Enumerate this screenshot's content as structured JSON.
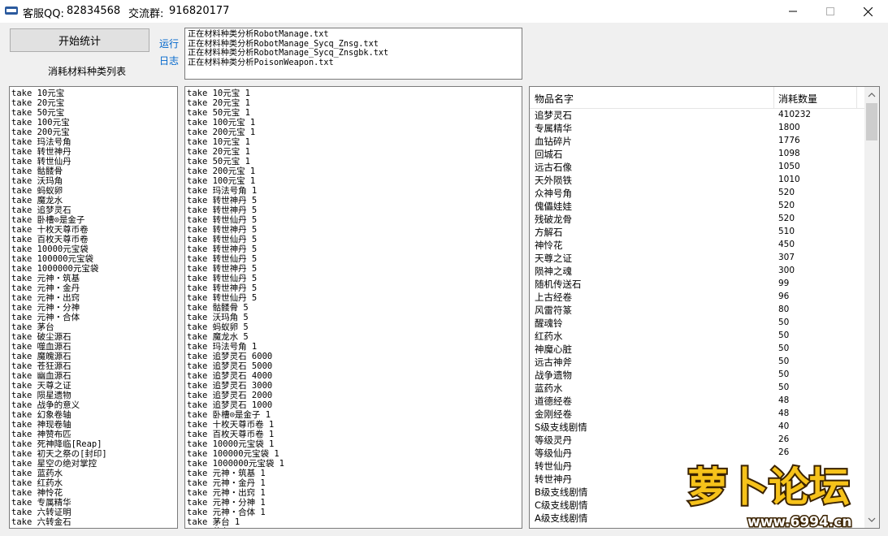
{
  "titlebar": {
    "qq_label": "客服QQ:",
    "qq_value": "82834568",
    "group_label": "交流群:",
    "group_value": "916820177"
  },
  "toolbar": {
    "start_button": "开始统计",
    "list_label": "消耗材料种类列表",
    "link_run": "运行",
    "link_log": "日志"
  },
  "log_lines": [
    "正在材料种类分析RobotManage.txt",
    "正在材料种类分析RobotManage_Sycq_Znsg.txt",
    "正在材料种类分析RobotManage_Sycq_Znsgbk.txt",
    "正在材料种类分析PoisonWeapon.txt"
  ],
  "type_list": [
    "take 10元宝",
    "take 20元宝",
    "take 50元宝",
    "take 100元宝",
    "take 200元宝",
    "take 玛法号角",
    "take 转世神丹",
    "take 转世仙丹",
    "take 骷髅骨",
    "take 沃玛角",
    "take 蚂蚁卵",
    "take 魔龙水",
    "take 追梦灵石",
    "take 卧槽⊙是金子",
    "take 十枚天尊币卷",
    "take 百枚天尊币卷",
    "take 10000元宝袋",
    "take 100000元宝袋",
    "take 1000000元宝袋",
    "take 元神・筑基",
    "take 元神・金丹",
    "take 元神・出窍",
    "take 元神・分神",
    "take 元神・合体",
    "take 茅台",
    "take 破尘源石",
    "take 噬血源石",
    "take 魔魄源石",
    "take 苍狂源石",
    "take 幽血源石",
    "take 天尊之证",
    "take 陨星遗物",
    "take 战争的意义",
    "take 幻象卷轴",
    "take 神现卷轴",
    "take 神赞布匹",
    "take 死神降临[Reap]",
    "take 初天之祭の[封印]",
    "take 星空の绝对掌控",
    "take 蓝药水",
    "take 红药水",
    "take 神怜花",
    "take 专属精华",
    "take 六转证明",
    "take 六转金石"
  ],
  "take_list": [
    "take 10元宝 1",
    "take 20元宝 1",
    "take 50元宝 1",
    "take 100元宝 1",
    "take 200元宝 1",
    "take 10元宝 1",
    "take 20元宝 1",
    "take 50元宝 1",
    "take 200元宝 1",
    "take 100元宝 1",
    "take 玛法号角 1",
    "take 转世神丹 5",
    "take 转世神丹 5",
    "take 转世仙丹 5",
    "take 转世神丹 5",
    "take 转世仙丹 5",
    "take 转世神丹 5",
    "take 转世仙丹 5",
    "take 转世神丹 5",
    "take 转世仙丹 5",
    "take 转世神丹 5",
    "take 转世仙丹 5",
    "take 骷髅骨 5",
    "take 沃玛角 5",
    "take 蚂蚁卵 5",
    "take 魔龙水 5",
    "take 玛法号角 1",
    "take 追梦灵石 6000",
    "take 追梦灵石 5000",
    "take 追梦灵石 4000",
    "take 追梦灵石 3000",
    "take 追梦灵石 2000",
    "take 追梦灵石 1000",
    "take 卧槽⊙是金子 1",
    "take 十枚天尊币卷 1",
    "take 百枚天尊币卷 1",
    "take 10000元宝袋 1",
    "take 100000元宝袋 1",
    "take 1000000元宝袋 1",
    "take 元神・筑基 1",
    "take 元神・金丹 1",
    "take 元神・出窍 1",
    "take 元神・分神 1",
    "take 元神・合体 1",
    "take 茅台 1",
    "take 茅台 1"
  ],
  "listview": {
    "col_name": "物品名字",
    "col_qty": "消耗数量",
    "rows": [
      {
        "name": "追梦灵石",
        "qty": "410232"
      },
      {
        "name": "专属精华",
        "qty": "1800"
      },
      {
        "name": "血钻碎片",
        "qty": "1776"
      },
      {
        "name": "回城石",
        "qty": "1098"
      },
      {
        "name": "远古石像",
        "qty": "1050"
      },
      {
        "name": "天外陨铁",
        "qty": "1010"
      },
      {
        "name": "众神号角",
        "qty": "520"
      },
      {
        "name": "傀儡娃娃",
        "qty": "520"
      },
      {
        "name": "残破龙骨",
        "qty": "520"
      },
      {
        "name": "方解石",
        "qty": "510"
      },
      {
        "name": "神怜花",
        "qty": "450"
      },
      {
        "name": "天尊之证",
        "qty": "307"
      },
      {
        "name": "陨神之魂",
        "qty": "300"
      },
      {
        "name": "随机传送石",
        "qty": "99"
      },
      {
        "name": "上古经卷",
        "qty": "96"
      },
      {
        "name": "风雷符篆",
        "qty": "80"
      },
      {
        "name": "醒魂铃",
        "qty": "50"
      },
      {
        "name": "红药水",
        "qty": "50"
      },
      {
        "name": "神魔心脏",
        "qty": "50"
      },
      {
        "name": "远古神斧",
        "qty": "50"
      },
      {
        "name": "战争遗物",
        "qty": "50"
      },
      {
        "name": "蓝药水",
        "qty": "50"
      },
      {
        "name": "道德经卷",
        "qty": "48"
      },
      {
        "name": "金刚经卷",
        "qty": "48"
      },
      {
        "name": "S级支线剧情",
        "qty": "40"
      },
      {
        "name": "等级灵丹",
        "qty": "26"
      },
      {
        "name": "等级仙丹",
        "qty": "26"
      },
      {
        "name": "转世仙丹",
        "qty": ""
      },
      {
        "name": "转世神丹",
        "qty": ""
      },
      {
        "name": "B级支线剧情",
        "qty": ""
      },
      {
        "name": "C级支线剧情",
        "qty": ""
      },
      {
        "name": "A级支线剧情",
        "qty": ""
      }
    ]
  },
  "watermark": {
    "text": "萝卜论坛",
    "url": "www.6994.cn"
  }
}
